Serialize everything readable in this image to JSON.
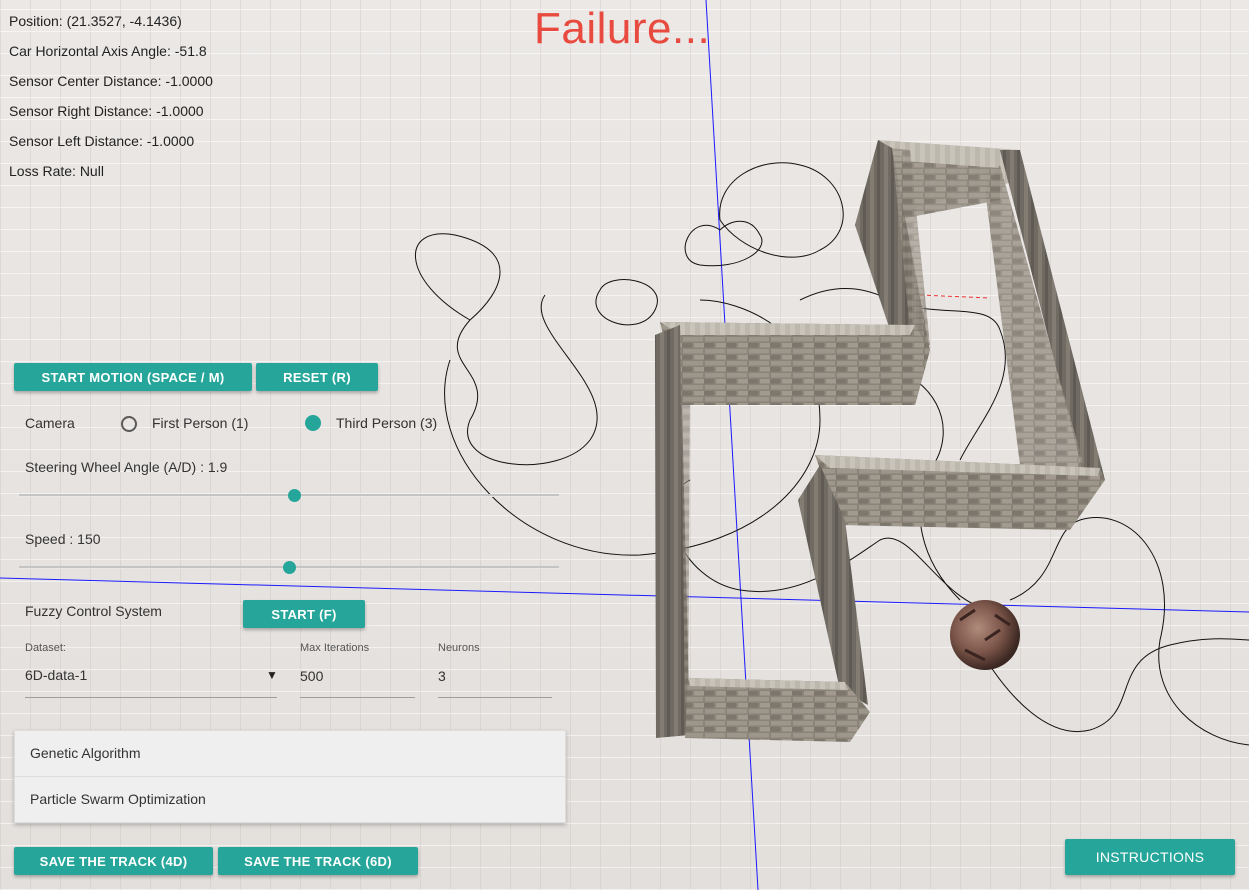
{
  "status": {
    "position": "Position: (21.3527, -4.1436)",
    "angle": "Car Horizontal Axis Angle: -51.8",
    "sensor_center": "Sensor Center Distance: -1.0000",
    "sensor_right": "Sensor Right Distance: -1.0000",
    "sensor_left": "Sensor Left Distance: -1.0000",
    "loss_rate": "Loss Rate: Null"
  },
  "result": {
    "text": "Failure..."
  },
  "controls": {
    "start_motion": "START MOTION (SPACE / M)",
    "reset": "RESET (R)"
  },
  "camera": {
    "label": "Camera",
    "first_person": "First Person (1)",
    "third_person": "Third Person (3)",
    "selected": "third"
  },
  "steering": {
    "label": "Steering Wheel Angle (A/D) : 1.9",
    "value_fraction": 0.51
  },
  "speed": {
    "label": "Speed : 150",
    "value_fraction": 0.5
  },
  "fuzzy": {
    "label": "Fuzzy Control System",
    "start": "START (F)"
  },
  "training": {
    "dataset_label": "Dataset:",
    "dataset_value": "6D-data-1",
    "max_iter_label": "Max Iterations",
    "max_iter_value": "500",
    "neurons_label": "Neurons",
    "neurons_value": "3"
  },
  "algorithms": [
    "Genetic Algorithm",
    "Particle Swarm Optimization"
  ],
  "save": {
    "save4d": "SAVE THE TRACK (4D)",
    "save6d": "SAVE THE TRACK (6D)"
  },
  "instructions": "INSTRUCTIONS",
  "colors": {
    "accent": "#26a69a",
    "failure": "#e84a3f",
    "axis": "#1a1aff"
  }
}
